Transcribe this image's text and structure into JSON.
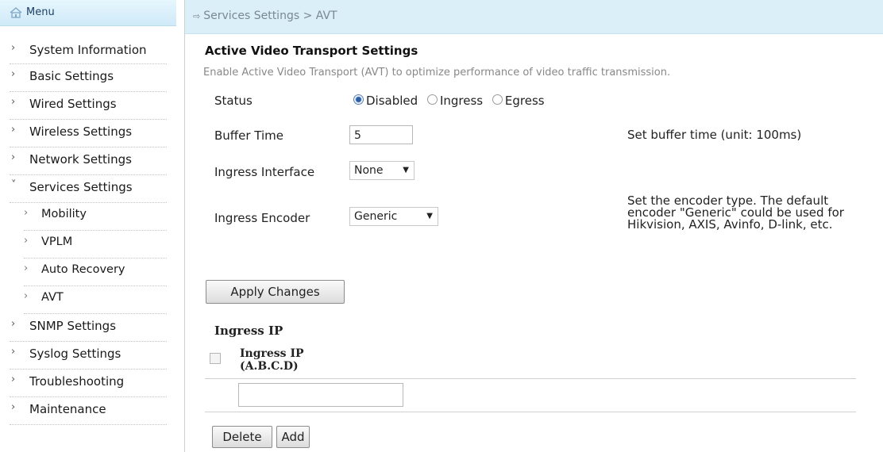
{
  "menu": {
    "title": "Menu",
    "items": [
      {
        "label": "System Information"
      },
      {
        "label": "Basic Settings"
      },
      {
        "label": "Wired Settings"
      },
      {
        "label": "Wireless Settings"
      },
      {
        "label": "Network Settings"
      },
      {
        "label": "Services Settings"
      },
      {
        "label": "Mobility"
      },
      {
        "label": "VPLM"
      },
      {
        "label": "Auto Recovery"
      },
      {
        "label": "AVT"
      },
      {
        "label": "SNMP Settings"
      },
      {
        "label": "Syslog Settings"
      },
      {
        "label": "Troubleshooting"
      },
      {
        "label": "Maintenance"
      }
    ]
  },
  "breadcrumb": "Services Settings > AVT",
  "section": {
    "title": "Active Video Transport Settings",
    "description": "Enable Active Video Transport (AVT) to optimize performance of video traffic transmission."
  },
  "form": {
    "status": {
      "label": "Status",
      "options": [
        "Disabled",
        "Ingress",
        "Egress"
      ],
      "selected": "Disabled"
    },
    "buffer_time": {
      "label": "Buffer Time",
      "value": "5",
      "note": "Set buffer time (unit: 100ms)"
    },
    "ingress_interface": {
      "label": "Ingress Interface",
      "value": "None"
    },
    "ingress_encoder": {
      "label": "Ingress Encoder",
      "value": "Generic",
      "note_line1": "Set the encoder type. The default",
      "note_line2": "encoder \"Generic\" could be used for",
      "note_line3": "Hikvision, AXIS, Avinfo, D-link, etc."
    },
    "apply_label": "Apply Changes"
  },
  "ingress_ip": {
    "title": "Ingress IP",
    "column_line1": "Ingress IP",
    "column_line2": "(A.B.C.D)",
    "input_value": "",
    "delete_label": "Delete",
    "add_label": "Add"
  },
  "colors": {
    "accent": "#2b5fa8",
    "topbar": "#dbeff9"
  }
}
